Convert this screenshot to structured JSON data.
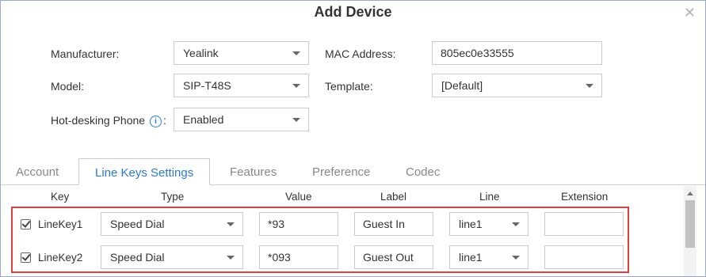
{
  "dialog": {
    "title": "Add Device"
  },
  "form": {
    "manufacturer_label": "Manufacturer:",
    "manufacturer_value": "Yealink",
    "model_label": "Model:",
    "model_value": "SIP-T48S",
    "hotdesk_label": "Hot-desking Phone",
    "hotdesk_suffix": ":",
    "hotdesk_value": "Enabled",
    "mac_label": "MAC Address:",
    "mac_value": "805ec0e33555",
    "template_label": "Template:",
    "template_value": "[Default]"
  },
  "tabs": [
    "Account",
    "Line Keys Settings",
    "Features",
    "Preference",
    "Codec"
  ],
  "active_tab": "Line Keys Settings",
  "table": {
    "headers": [
      "Key",
      "Type",
      "Value",
      "Label",
      "Line",
      "Extension"
    ],
    "rows": [
      {
        "checked": true,
        "key": "LineKey1",
        "type": "Speed Dial",
        "value": "*93",
        "label": "Guest In",
        "line": "line1",
        "extension": ""
      },
      {
        "checked": true,
        "key": "LineKey2",
        "type": "Speed Dial",
        "value": "*093",
        "label": "Guest Out",
        "line": "line1",
        "extension": ""
      }
    ]
  },
  "colors": {
    "accent": "#2a7ad2",
    "highlight_border": "#e0403c",
    "dialog_border": "#9aa9c6"
  },
  "icons": {
    "close": "close-icon",
    "info": "info-icon",
    "caret": "chevron-down-icon",
    "checkbox": "checkbox-checked-icon"
  }
}
